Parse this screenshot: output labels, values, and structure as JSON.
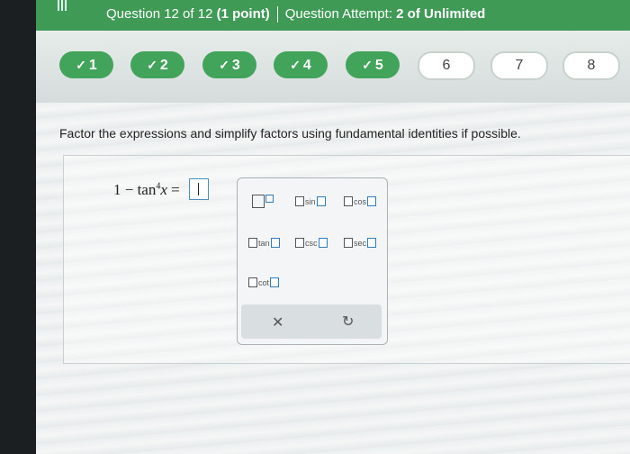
{
  "header": {
    "question_text": "Question 12 of 12",
    "points_text": "(1 point)",
    "attempt_label": "Question Attempt:",
    "attempt_value": "2 of Unlimited"
  },
  "question_nav": [
    {
      "label": "1",
      "status": "done"
    },
    {
      "label": "2",
      "status": "done"
    },
    {
      "label": "3",
      "status": "done"
    },
    {
      "label": "4",
      "status": "done"
    },
    {
      "label": "5",
      "status": "done"
    },
    {
      "label": "6",
      "status": "todo"
    },
    {
      "label": "7",
      "status": "todo"
    },
    {
      "label": "8",
      "status": "todo"
    }
  ],
  "check_glyph": "✓",
  "instruction": "Factor the expressions and simplify factors using fundamental identities if possible.",
  "equation": {
    "prefix": "1 − tan",
    "exponent": "4",
    "variable": "x",
    "equals": " ="
  },
  "palette": {
    "functions": [
      "sin",
      "cos",
      "tan",
      "csc",
      "sec",
      "cot"
    ],
    "clear_glyph": "✕",
    "undo_glyph": "↻"
  },
  "colors": {
    "header_green": "#3f9a56",
    "done_green": "#42a35a"
  }
}
